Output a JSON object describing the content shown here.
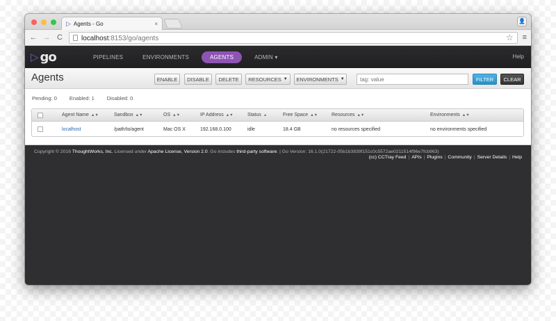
{
  "browser": {
    "tab_title": "Agents - Go",
    "tab_close": "×",
    "url_host": "localhost",
    "url_path": ":8153/go/agents",
    "back_glyph": "←",
    "forward_glyph": "→",
    "reload_glyph": "C",
    "star_glyph": "☆",
    "menu_glyph": "≡",
    "profile_glyph": "👤"
  },
  "app": {
    "logo_text": "go",
    "nav": [
      "PIPELINES",
      "ENVIRONMENTS",
      "AGENTS",
      "ADMIN ▾"
    ],
    "help": "Help",
    "accent_color": "#8e54b3"
  },
  "page": {
    "title": "Agents",
    "buttons": {
      "enable": "ENABLE",
      "disable": "DISABLE",
      "delete": "DELETE",
      "resources": "RESOURCES",
      "environments": "ENVIRONMENTS",
      "filter": "FILTER",
      "clear": "CLEAR"
    },
    "tag_placeholder": "tag: value",
    "stats": {
      "pending": "Pending: 0",
      "enabled": "Enabled: 1",
      "disabled": "Disabled: 0"
    }
  },
  "table": {
    "headers": [
      "Agent Name",
      "Sandbox",
      "OS",
      "IP Address",
      "Status",
      "Free Space",
      "Resources",
      "Environments"
    ],
    "sorted_column": "Status",
    "rows": [
      {
        "name": "localhost",
        "sandbox": "/path/to/agent",
        "os": "Mac OS X",
        "ip": "192.168.0.100",
        "status": "idle",
        "free_space": "18.4 GB",
        "resources": "no resources specified",
        "environments": "no environments specified"
      }
    ]
  },
  "footer": {
    "copyright_prefix": "Copyright © 2016 ",
    "company": "ThoughtWorks, Inc.",
    "licensed_under": " Licensed under ",
    "license": "Apache License, Version 2.0",
    "includes": ". Go includes ",
    "third_party": "third-party software",
    "version": ". | Go Version: 16.1.0(21722-05b1b3839f151c0c5572ae0211514f96e7fcb963)",
    "links": [
      "(cc) CCTray Feed",
      "APIs",
      "Plugins",
      "Community",
      "Server Details",
      "Help"
    ]
  }
}
